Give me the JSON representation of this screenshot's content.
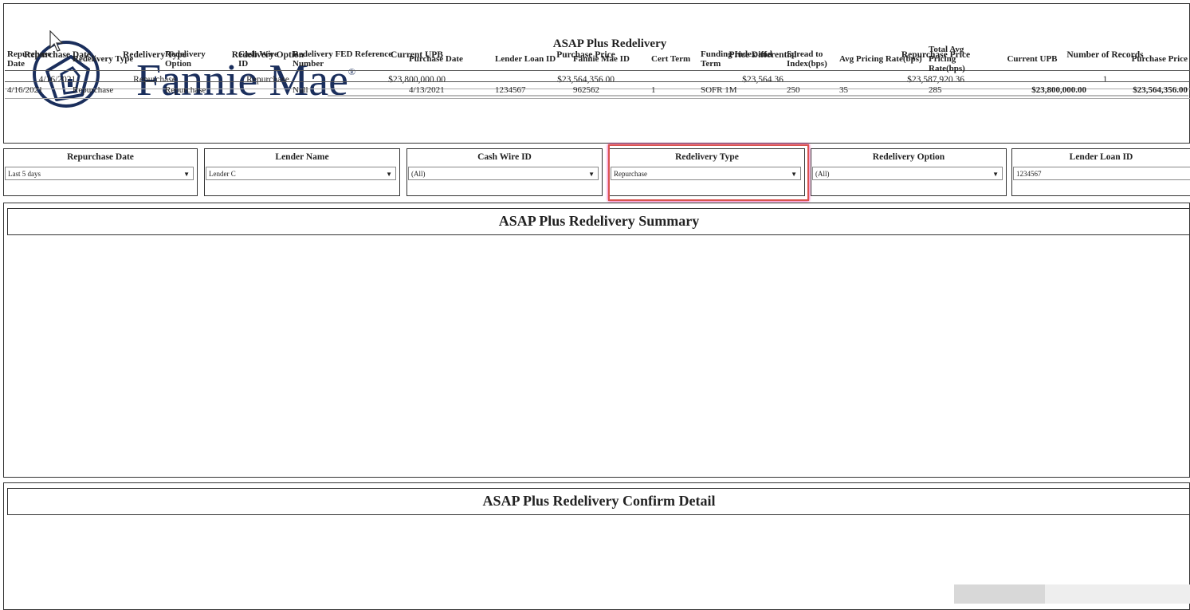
{
  "header": {
    "logo_text": "Fannie Mae",
    "logo_mark": "®",
    "report_title": "ASAP Plus Redelivery"
  },
  "filters": [
    {
      "label": "Repurchase Date",
      "value": "Last 5 days",
      "has_dropdown": true
    },
    {
      "label": "Lender Name",
      "value": "Lender C",
      "has_dropdown": true
    },
    {
      "label": "Cash Wire ID",
      "value": "(All)",
      "has_dropdown": true
    },
    {
      "label": "Redelivery Type",
      "value": "Repurchase",
      "has_dropdown": true
    },
    {
      "label": "Redelivery Option",
      "value": "(All)",
      "has_dropdown": true
    },
    {
      "label": "Lender Loan ID",
      "value": "1234567",
      "has_dropdown": false
    }
  ],
  "summary": {
    "title": "ASAP Plus Redelivery Summary",
    "columns": [
      "Repurchase Date",
      "Redelivery Type",
      "Redelivery Option",
      "Current UPB",
      "Purchase Price",
      "Price Differential",
      "Repurchase Price",
      "Number of Records"
    ],
    "rows": [
      [
        "4/16/2021",
        "Repurchase",
        "Repurchase",
        "$23,800,000.00",
        "$23,564,356.00",
        "$23,564.36",
        "$23,587,920.36",
        "1"
      ]
    ]
  },
  "detail": {
    "title": "ASAP Plus Redelivery Confirm Detail",
    "columns": [
      "Repurchase Date",
      "Redelivery Type",
      "Redelivery Option",
      "Cash Wire ID",
      "Redelivery FED Reference Number",
      "Purchase Date",
      "Lender Loan ID",
      "Fannie Mae ID",
      "Cert Term",
      "Funding Index and Term",
      "Spread to Index(bps)",
      "Avg Pricing Rate(bps)",
      "Total Avg Pricing Rate(bps)",
      "Current UPB",
      "Purchase Price"
    ],
    "rows": [
      [
        "4/16/2021",
        "Repurchase",
        "Repurchase",
        "",
        "Null",
        "4/13/2021",
        "1234567",
        "962562",
        "1",
        "SOFR 1M",
        "250",
        "35",
        "285",
        "$23,800,000.00",
        "$23,564,356.00"
      ]
    ]
  },
  "colors": {
    "logo": "#1a2e5c",
    "highlight": "#d9534f"
  }
}
